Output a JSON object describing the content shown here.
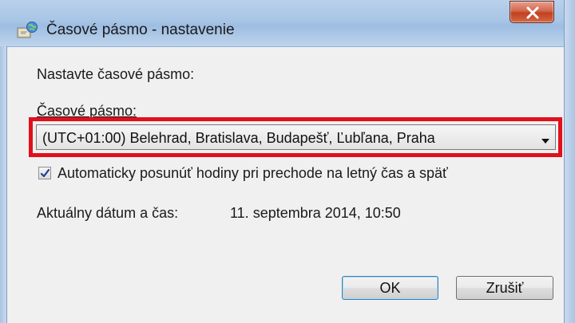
{
  "window": {
    "title": "Časové pásmo - nastavenie",
    "close_glyph": "x"
  },
  "prompt_label": "Nastavte časové pásmo:",
  "timezone": {
    "label": "Časové pásmo:",
    "selected": "(UTC+01:00) Belehrad, Bratislava, Budapešť, Ľubľana, Praha"
  },
  "dst_checkbox": {
    "label": "Automaticky posunúť hodiny pri prechode na letný čas a späť",
    "checked": true
  },
  "current_datetime": {
    "label": "Aktuálny dátum a čas:",
    "value": "11. septembra 2014, 10:50"
  },
  "buttons": {
    "ok": "OK",
    "cancel": "Zrušiť"
  },
  "colors": {
    "highlight": "#e0101c",
    "close_button": "#c1401f",
    "titlebar": "#a8c5e6"
  },
  "icons": {
    "title": "clock-globe-icon",
    "close": "close-icon",
    "dropdown": "chevron-down-icon",
    "checkbox": "checkmark-icon"
  }
}
